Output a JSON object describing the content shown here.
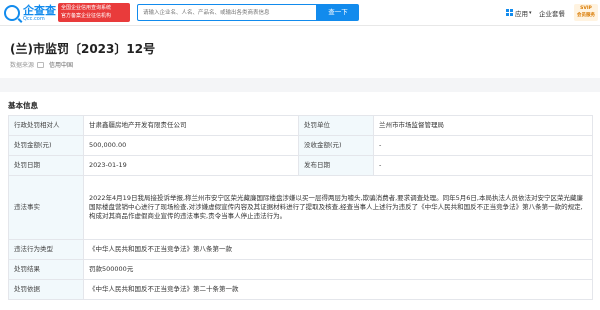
{
  "header": {
    "logo_cn": "企查查",
    "logo_en": "Qcc.com",
    "cert_line1": "全国企业信用查询系统",
    "cert_line2": "官方备案企业征信机构",
    "search_placeholder": "请输入企业名、人名、产品名、或输出各类商表信息",
    "search_button": "查一下",
    "nav_app": "应用",
    "nav_plan": "企业套餐",
    "vip_line1": "SVIP",
    "vip_line2": "会员服务"
  },
  "title": "(兰)市监罚〔2023〕12号",
  "source": {
    "label": "数据来源",
    "value": "信用中国"
  },
  "section_title": "基本信息",
  "table": {
    "r1": {
      "l1": "行政处罚相对人",
      "v1": "甘肃鑫疆房地产开发有限责任公司",
      "l2": "处罚单位",
      "v2": "兰州市市场监督管理局"
    },
    "r2": {
      "l1": "处罚金额(元)",
      "v1": "500,000.00",
      "l2": "没收金额(元)",
      "v2": "-"
    },
    "r3": {
      "l1": "处罚日期",
      "v1": "2023-01-19",
      "l2": "发布日期",
      "v2": "-"
    },
    "r4": {
      "l1": "违法事实",
      "v1": "2022年4月19日我局接投诉举报,称兰州市安宁区荣光藏廉国际楼盘涉嫌以买一层得两层为噱头,欺骗消费者,要求调查处理。同年5月6日,本局执法人员依法对安宁区荣光藏廉国际楼盘营销中心进行了现场检查,对涉嫌虚假宣传内容及其证据材料进行了提取及核查,经查当事人上述行为违反了《中华人民共和国反不正当竞争法》第八条第一款的规定,构成对其商品作虚假商业宣传的违法事实,责令当事人停止违法行为。"
    },
    "r5": {
      "l1": "违法行为类型",
      "v1": "《中华人民共和国反不正当竞争法》第八条第一款"
    },
    "r6": {
      "l1": "处罚结果",
      "v1": "罚款500000元"
    },
    "r7": {
      "l1": "处罚依据",
      "v1": "《中华人民共和国反不正当竞争法》第二十条第一款"
    }
  },
  "colors": {
    "brand": "#128bed",
    "label_bg": "#f2f9fc",
    "badge_red": "#e93b3b"
  }
}
